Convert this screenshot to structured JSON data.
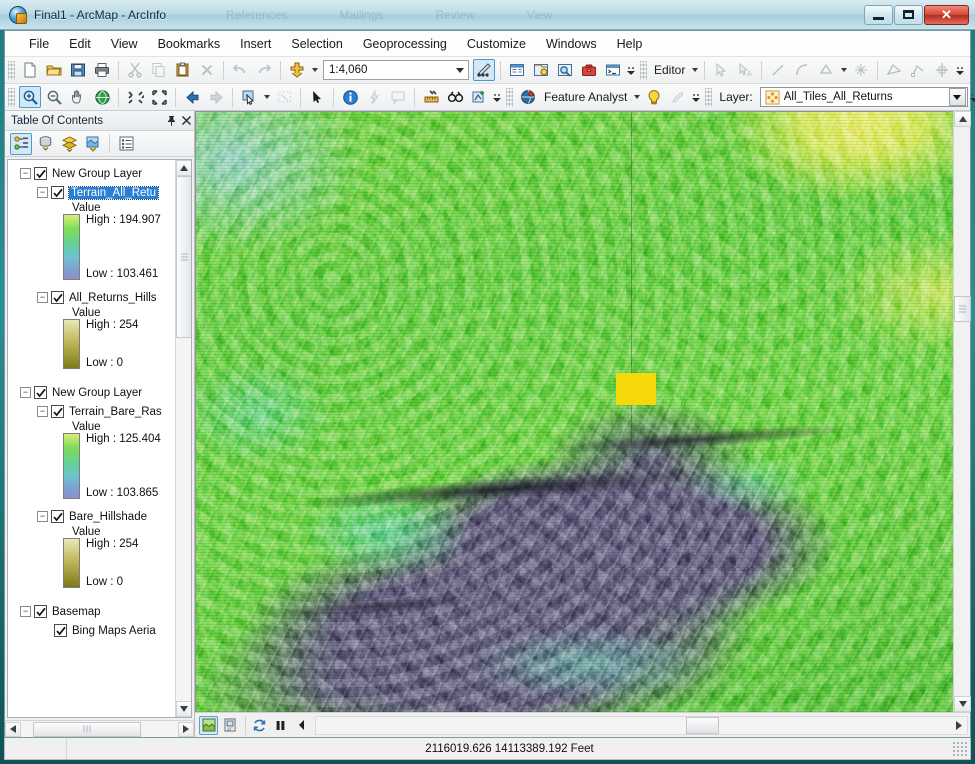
{
  "window": {
    "title": "Final1 - ArcMap - ArcInfo",
    "icon": "arcmap-globe-icon",
    "ghost_tabs": [
      "References",
      "Mailings",
      "Review",
      "View"
    ],
    "controls": {
      "minimize": "Minimize",
      "maximize": "Maximize",
      "close": "Close"
    }
  },
  "menubar": {
    "items": [
      "File",
      "Edit",
      "View",
      "Bookmarks",
      "Insert",
      "Selection",
      "Geoprocessing",
      "Customize",
      "Windows",
      "Help"
    ]
  },
  "standard_toolbar": {
    "buttons": [
      "new-map-icon",
      "open-icon",
      "save-icon",
      "print-icon",
      "cut-icon",
      "copy-icon",
      "paste-icon",
      "delete-icon",
      "undo-icon",
      "redo-icon",
      "add-data-icon"
    ],
    "scale": {
      "label": "Map Scale",
      "value": "1:4,060"
    },
    "right_buttons": [
      "editor-toolbar-icon",
      "table-of-contents-icon",
      "catalog-icon",
      "search-icon",
      "arctoolbox-icon",
      "python-window-icon"
    ]
  },
  "tools_toolbar": {
    "buttons": [
      "zoom-in-icon",
      "zoom-out-icon",
      "pan-icon",
      "full-extent-icon",
      "fixed-zoom-in-icon",
      "fixed-zoom-out-icon",
      "go-back-icon",
      "go-forward-icon",
      "select-features-icon",
      "clear-selection-icon",
      "select-elements-icon",
      "identify-icon",
      "hyperlink-icon",
      "html-popup-icon",
      "measure-icon",
      "find-icon",
      "find-route-icon"
    ]
  },
  "editor_toolbar": {
    "menu_label": "Editor",
    "buttons": [
      "edit-tool-icon",
      "edit-annotation-icon",
      "straight-segment-icon",
      "arc-segment-icon",
      "construction-tools-icon",
      "split-icon",
      "trace-icon",
      "modify-feature-icon",
      "reshape-icon"
    ]
  },
  "feature_analyst_toolbar": {
    "menu_label": "Feature Analyst",
    "buttons": [
      "feature-analyst-icon",
      "learn-icon",
      "pencil-icon"
    ]
  },
  "layer_toolbar": {
    "label": "Layer:",
    "selected_layer": "All_Tiles_All_Returns",
    "layer_icon": "point-features-icon"
  },
  "toc": {
    "title": "Table Of Contents",
    "auto_hide_label": "Auto Hide",
    "close_label": "Close",
    "toolbar_buttons": [
      "list-by-drawing-order-icon",
      "list-by-source-icon",
      "list-by-visibility-icon",
      "list-by-selection-icon",
      "options-icon"
    ],
    "tree": [
      {
        "name": "New Group Layer",
        "type": "group",
        "checked": true,
        "expanded": true,
        "indent": 0,
        "selected": false
      },
      {
        "name": "Terrain_All_Retu",
        "type": "raster",
        "checked": true,
        "expanded": true,
        "indent": 1,
        "selected": true,
        "legend": {
          "value_label": "Value",
          "high": "High : 194.907",
          "low": "Low : 103.461",
          "ramp": "terrain"
        }
      },
      {
        "name": "All_Returns_Hills",
        "type": "raster",
        "checked": true,
        "expanded": true,
        "indent": 1,
        "selected": false,
        "legend": {
          "value_label": "Value",
          "high": "High : 254",
          "low": "Low : 0",
          "ramp": "hillshade"
        }
      },
      {
        "name": "New Group Layer",
        "type": "group",
        "checked": true,
        "expanded": true,
        "indent": 0,
        "selected": false
      },
      {
        "name": "Terrain_Bare_Ras",
        "type": "raster",
        "checked": true,
        "expanded": true,
        "indent": 1,
        "selected": false,
        "legend": {
          "value_label": "Value",
          "high": "High : 125.404",
          "low": "Low : 103.865",
          "ramp": "terrain"
        }
      },
      {
        "name": "Bare_Hillshade",
        "type": "raster",
        "checked": true,
        "expanded": true,
        "indent": 1,
        "selected": false,
        "legend": {
          "value_label": "Value",
          "high": "High : 254",
          "low": "Low : 0",
          "ramp": "hillshade"
        }
      },
      {
        "name": "Basemap",
        "type": "group",
        "checked": true,
        "expanded": true,
        "indent": 0,
        "selected": false
      },
      {
        "name": "Bing Maps Aeria",
        "type": "service",
        "checked": true,
        "expanded": false,
        "indent": 1,
        "selected": false
      }
    ]
  },
  "map_view": {
    "view_buttons": [
      "data-view-icon",
      "layout-view-icon"
    ],
    "refresh_label": "refresh-icon",
    "pause_label": "pause-drawing-icon",
    "prev_extent_label": "previous-extent-icon",
    "description": "Hillshaded LiDAR terrain raster, green uplands with yellow high ground at upper right and a dark purple river valley across the lower left; a small yellow point-feature cluster sits at the valley headland."
  },
  "statusbar": {
    "coordinates": "2116019.626  14113389.192 Feet"
  },
  "colors": {
    "title_gradient_top": "#d9ecf2",
    "frame": "#2a8f93",
    "selection_blue": "#2a7fd4",
    "toolbar_bg": "#f0f0f0",
    "map_green": "#7ed84f",
    "map_valley": "#6b6784",
    "map_high": "#e8ee72",
    "point_yellow": "#f5d90a"
  }
}
